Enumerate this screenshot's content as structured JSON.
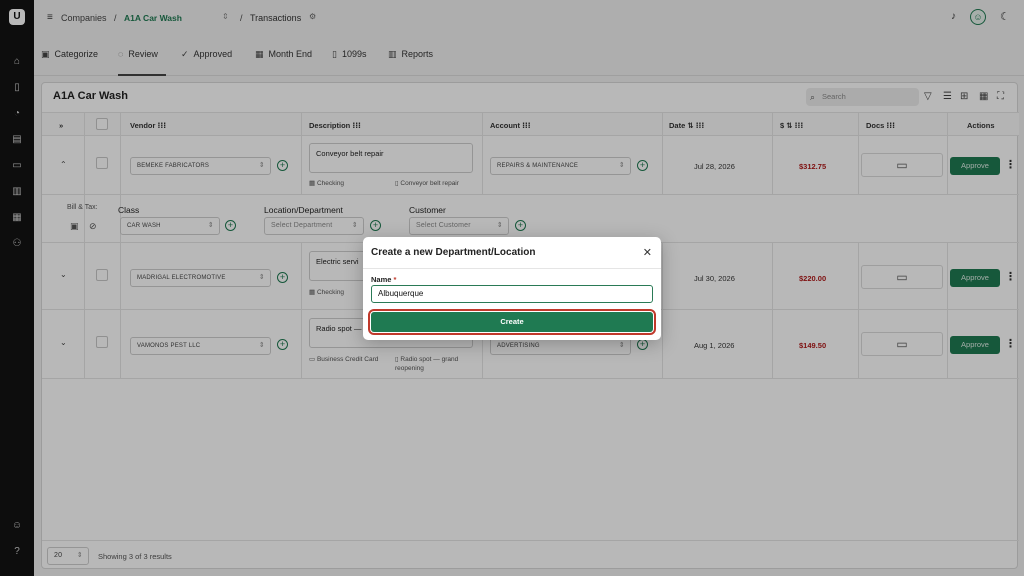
{
  "sidebar": {
    "logo": "U"
  },
  "topbar": {
    "menu_icon": "≡",
    "companies": "Companies",
    "sep1": "/",
    "company": "A1A Car Wash",
    "sep2": "/",
    "page": "Transactions"
  },
  "tabs": [
    {
      "label": "Categorize",
      "icon": "categorize-icon"
    },
    {
      "label": "Review",
      "icon": "review-icon",
      "active": true
    },
    {
      "label": "Approved",
      "icon": "approved-icon"
    },
    {
      "label": "Month End",
      "icon": "calendar-icon"
    },
    {
      "label": "1099s",
      "icon": "document-icon"
    },
    {
      "label": "Reports",
      "icon": "reports-icon"
    }
  ],
  "card": {
    "title": "A1A Car Wash",
    "search_placeholder": "Search"
  },
  "columns": {
    "expand": "»",
    "vendor": "Vendor ⁝⁝⁝",
    "description": "Description ⁝⁝⁝",
    "account": "Account ⁝⁝⁝",
    "date": "Date ⇅ ⁝⁝⁝",
    "amount": "$ ⇅ ⁝⁝⁝",
    "docs": "Docs ⁝⁝⁝",
    "actions": "Actions"
  },
  "rows": [
    {
      "vendor": "BEMEKE FABRICATORS",
      "description": "Conveyor belt repair",
      "payment": "Checking",
      "doc_note": "Conveyor belt repair",
      "account": "REPAIRS & MAINTENANCE",
      "date": "Jul 28, 2026",
      "amount": "$312.75",
      "action": "Approve"
    },
    {
      "vendor": "MADRIGAL ELECTROMOTIVE",
      "description": "Electric servi",
      "payment": "Checking",
      "doc_note": "",
      "account": "",
      "date": "Jul 30, 2026",
      "amount": "$220.00",
      "action": "Approve"
    },
    {
      "vendor": "VAMONOS PEST LLC",
      "description": "Radio spot —",
      "payment": "Business Credit Card",
      "doc_note": "Radio spot — grand reopening",
      "account": "ADVERTISING",
      "date": "Aug 1, 2026",
      "amount": "$149.50",
      "action": "Approve"
    }
  ],
  "detail": {
    "bill_tax": "Bill & Tax:",
    "class_label": "Class",
    "class_value": "CAR WASH",
    "location_label": "Location/Department",
    "location_placeholder": "Select Department",
    "customer_label": "Customer",
    "customer_placeholder": "Select Customer"
  },
  "footer": {
    "page_size": "20",
    "results": "Showing 3 of 3 results"
  },
  "modal": {
    "title": "Create a new Department/Location",
    "name_label": "Name",
    "required_mark": "*",
    "name_value": "Albuquerque",
    "create_label": "Create"
  },
  "colors": {
    "accent": "#1f7a52",
    "amount": "#b11a1a",
    "sidebar": "#121212"
  }
}
